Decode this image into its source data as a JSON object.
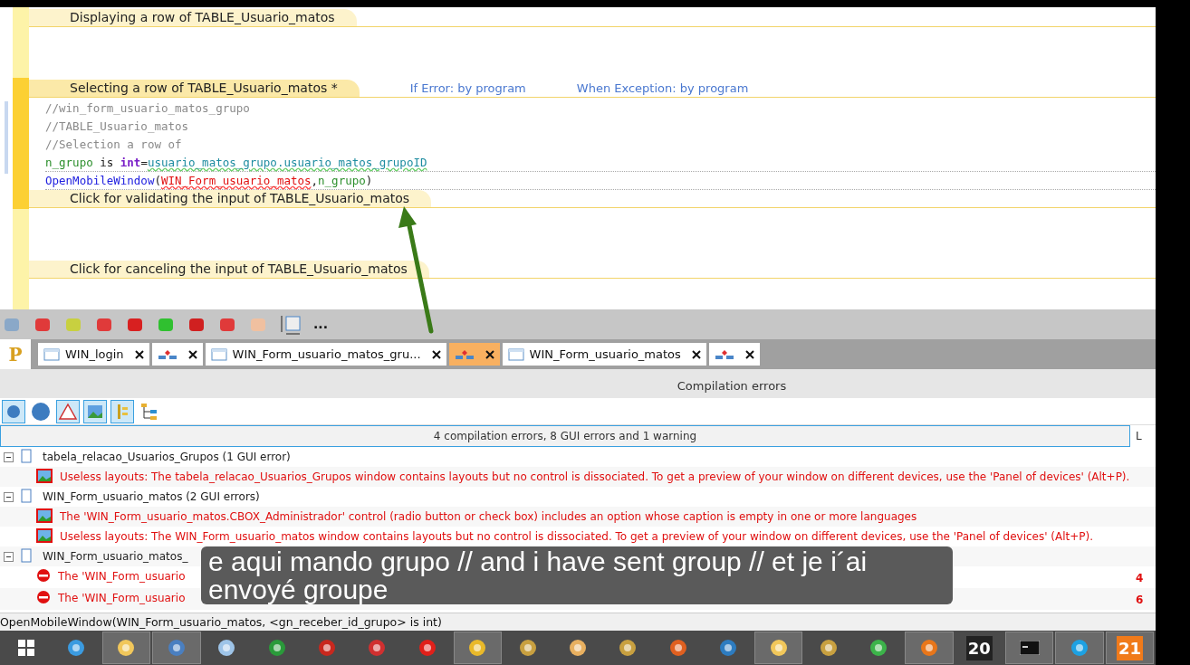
{
  "editor": {
    "sections": [
      {
        "title": "Displaying a row of TABLE_Usuario_matos",
        "active": false
      },
      {
        "title": "Selecting a row of TABLE_Usuario_matos *",
        "active": true,
        "notes": [
          "If Error: by program",
          "When Exception: by program"
        ],
        "lines": [
          [
            {
              "kind": "comment",
              "text": "//win_form_usuario_matos_grupo"
            }
          ],
          [
            {
              "kind": "comment",
              "text": "//TABLE_Usuario_matos"
            }
          ],
          [
            {
              "kind": "comment",
              "text": "//Selection a row of"
            }
          ],
          [
            {
              "kind": "var",
              "text": "n_grupo"
            },
            {
              "kind": "plain",
              "text": " is "
            },
            {
              "kind": "keyword",
              "text": "int"
            },
            {
              "kind": "plain",
              "text": "="
            },
            {
              "kind": "field",
              "text": "usuario_matos_grupo.usuario_matos_grupoID"
            }
          ],
          [
            {
              "kind": "func",
              "text": "OpenMobileWindow"
            },
            {
              "kind": "plain",
              "text": "("
            },
            {
              "kind": "error",
              "text": "WIN_Form_usuario_matos"
            },
            {
              "kind": "plain",
              "text": ","
            },
            {
              "kind": "var",
              "text": "n_grupo"
            },
            {
              "kind": "plain",
              "text": ")"
            }
          ]
        ]
      },
      {
        "title": "Click for validating the input of TABLE_Usuario_matos",
        "active": false
      },
      {
        "title": "Click for canceling the input of TABLE_Usuario_matos",
        "active": false
      }
    ]
  },
  "toolbar": {
    "more": "..."
  },
  "project_logo": "P",
  "tabs": [
    {
      "kind": "window",
      "label": "WIN_login",
      "selected": false
    },
    {
      "kind": "diagram",
      "selected": false
    },
    {
      "kind": "window",
      "label": "WIN_Form_usuario_matos_gru...",
      "selected": false
    },
    {
      "kind": "diagram",
      "selected": true
    },
    {
      "kind": "window",
      "label": "WIN_Form_usuario_matos",
      "selected": false
    },
    {
      "kind": "diagram",
      "selected": false
    }
  ],
  "pane": {
    "title": "Compilation errors",
    "filters": [
      {
        "kind": "info",
        "selected": false
      },
      {
        "kind": "warning",
        "selected": true
      },
      {
        "kind": "gui",
        "selected": true
      },
      {
        "kind": "tree",
        "selected": true
      },
      {
        "kind": "hierarchy",
        "selected": false
      }
    ],
    "summary": "4 compilation errors, 8 GUI errors and 1 warning",
    "column_2": "L",
    "rows": [
      {
        "kind": "group",
        "text": "tabela_relacao_Usuarios_Grupos (1 GUI error)"
      },
      {
        "kind": "gui",
        "text": "Useless layouts: The tabela_relacao_Usuarios_Grupos window contains layouts but no control is dissociated. To get a preview of your window on different devices, use the 'Panel of devices' (Alt+P)."
      },
      {
        "kind": "group",
        "text": "WIN_Form_usuario_matos (2 GUI errors)"
      },
      {
        "kind": "gui",
        "text": "The 'WIN_Form_usuario_matos.CBOX_Administrador' control (radio button or check box) includes an option whose caption is empty in one or more languages"
      },
      {
        "kind": "gui",
        "text": "Useless layouts: The WIN_Form_usuario_matos window contains layouts but no control is dissociated. To get a preview of your window on different devices, use the 'Panel of devices' (Alt+P)."
      },
      {
        "kind": "group",
        "text": "WIN_Form_usuario_matos_"
      },
      {
        "kind": "error",
        "text": "The 'WIN_Form_usuario",
        "line": "4"
      },
      {
        "kind": "error",
        "text": "The 'WIN_Form_usuario",
        "line": "6"
      }
    ]
  },
  "status_bar": "OpenMobileWindow(WIN_Form_usuario_matos, <gn_receber_id_grupo> is int)",
  "subtitle": "e aqui mando grupo // and i have sent group // et je i´ai envoyé groupe",
  "taskbar": [
    {
      "kind": "start",
      "active": false
    },
    {
      "kind": "browser",
      "active": false
    },
    {
      "kind": "folder",
      "active": true
    },
    {
      "kind": "remote",
      "active": true
    },
    {
      "kind": "notepad",
      "active": false
    },
    {
      "kind": "eye",
      "active": false
    },
    {
      "kind": "ftp",
      "active": false
    },
    {
      "kind": "app",
      "active": false
    },
    {
      "kind": "opera",
      "active": false
    },
    {
      "kind": "chrome",
      "active": true
    },
    {
      "kind": "gear",
      "active": false
    },
    {
      "kind": "burger",
      "active": false
    },
    {
      "kind": "gear",
      "active": false
    },
    {
      "kind": "triangle",
      "active": false
    },
    {
      "kind": "globe",
      "active": false
    },
    {
      "kind": "folder",
      "active": true
    },
    {
      "kind": "gear",
      "active": false
    },
    {
      "kind": "android",
      "active": false
    },
    {
      "kind": "firefox",
      "active": true
    },
    {
      "kind": "counter",
      "label": "20",
      "active": false
    },
    {
      "kind": "terminal",
      "active": true
    },
    {
      "kind": "chat",
      "active": true
    },
    {
      "kind": "counter",
      "label": "21",
      "active": true
    }
  ]
}
